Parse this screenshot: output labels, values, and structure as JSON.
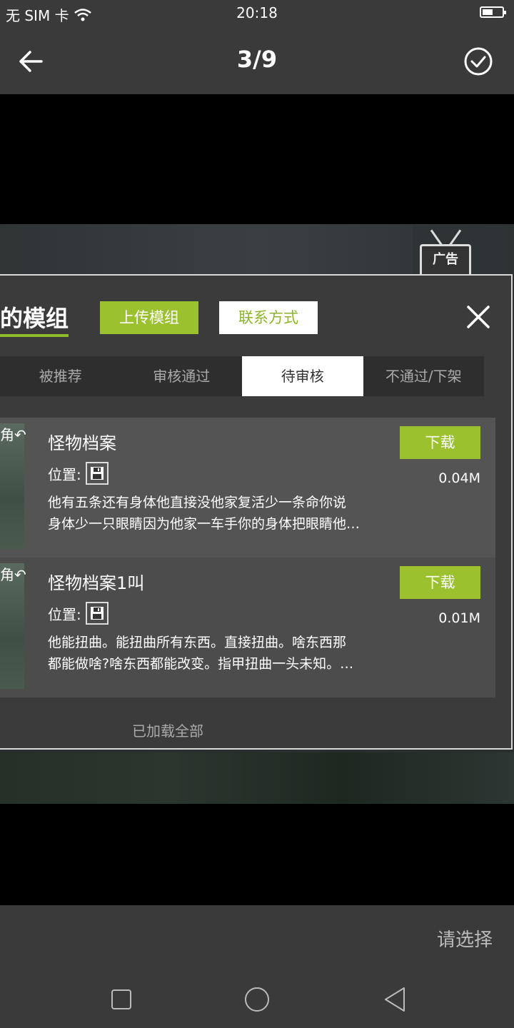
{
  "status_bar": {
    "carrier": "无 SIM 卡",
    "time": "20:18",
    "battery_level": 0.55
  },
  "top_bar": {
    "counter": "3/9",
    "back_icon": "arrow-left-icon",
    "confirm_icon": "check-circle-icon"
  },
  "panel": {
    "title": "的模组",
    "upload_button": "上传模组",
    "contact_button": "联系方式",
    "close_icon": "close-icon",
    "ad_label": "广告",
    "tabs": [
      {
        "label": "被推荐",
        "active": false
      },
      {
        "label": "审核通过",
        "active": false
      },
      {
        "label": "待审核",
        "active": true
      },
      {
        "label": "不通过/下架",
        "active": false
      }
    ],
    "items": [
      {
        "thumb_label": "角↶",
        "name": "怪物档案",
        "location_label": "位置:",
        "description_line1": "他有五条还有身体他直接没他家复活少一条命你说",
        "description_line2": "身体少一只眼睛因为他家一车手你的身体把眼睛他…",
        "download_label": "下载",
        "size": "0.04M"
      },
      {
        "thumb_label": "角↶",
        "name": "怪物档案1叫",
        "location_label": "位置:",
        "description_line1": "他能扭曲。能扭曲所有东西。直接扭曲。啥东西那",
        "description_line2": "都能做啥?啥东西都能改变。指甲扭曲一头未知。…",
        "download_label": "下载",
        "size": "0.01M"
      }
    ],
    "loaded_text": "已加载全部"
  },
  "action_bar": {
    "choose_label": "请选择"
  },
  "colors": {
    "accent_green": "#9bc12f",
    "bar_bg": "#3a3a3a"
  }
}
